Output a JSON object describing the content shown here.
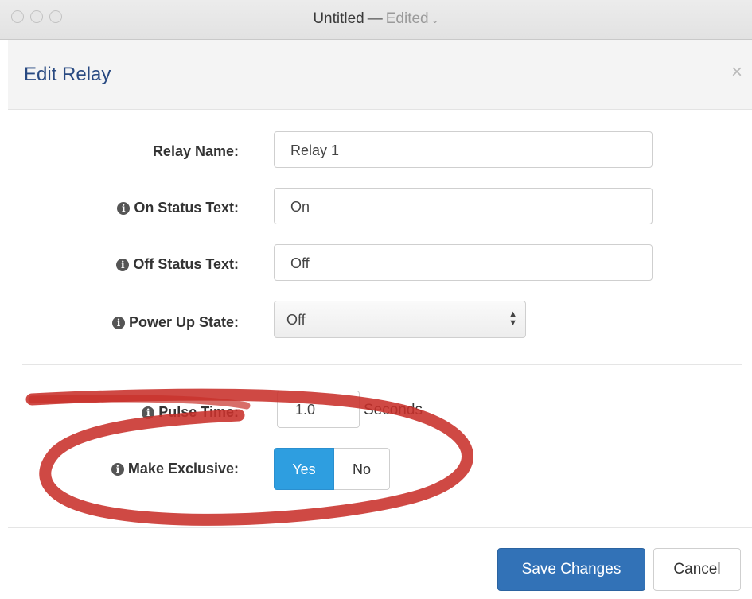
{
  "window": {
    "title": "Untitled",
    "separator": "—",
    "status": "Edited"
  },
  "modal": {
    "title": "Edit Relay",
    "close_glyph": "×"
  },
  "form": {
    "relay_name": {
      "label": "Relay Name:",
      "value": "Relay 1"
    },
    "on_status_text": {
      "label": "On Status Text:",
      "value": "On"
    },
    "off_status_text": {
      "label": "Off Status Text:",
      "value": "Off"
    },
    "power_up_state": {
      "label": "Power Up State:",
      "selected": "Off"
    },
    "pulse_time": {
      "label": "Pulse Time:",
      "value": "1.0",
      "unit": "Seconds"
    },
    "make_exclusive": {
      "label": "Make Exclusive:",
      "options": [
        "Yes",
        "No"
      ],
      "selected": "Yes"
    }
  },
  "footer": {
    "save_label": "Save Changes",
    "cancel_label": "Cancel"
  },
  "icons": {
    "info": "info-circle-icon",
    "close": "close-icon",
    "select_arrows": "updown-chevron-icon"
  },
  "colors": {
    "primary": "#3272b7",
    "toggle_active": "#2e9ee0",
    "title": "#294a82",
    "annotation_red": "#c8302a"
  }
}
